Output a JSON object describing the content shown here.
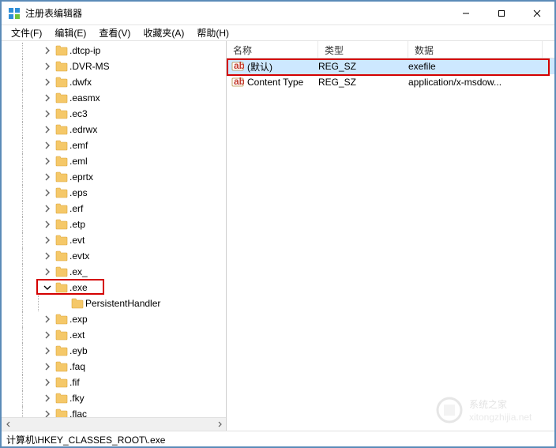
{
  "window": {
    "title": "注册表编辑器",
    "controls": {
      "min": "—",
      "max": "☐",
      "close": "✕"
    }
  },
  "menu": {
    "file": "文件(F)",
    "edit": "编辑(E)",
    "view": "查看(V)",
    "fav": "收藏夹(A)",
    "help": "帮助(H)"
  },
  "tree": {
    "items": [
      {
        "label": ".dtcp-ip",
        "depth": 3,
        "exp": "right"
      },
      {
        "label": ".DVR-MS",
        "depth": 3,
        "exp": "right"
      },
      {
        "label": ".dwfx",
        "depth": 3,
        "exp": "right"
      },
      {
        "label": ".easmx",
        "depth": 3,
        "exp": "right"
      },
      {
        "label": ".ec3",
        "depth": 3,
        "exp": "right"
      },
      {
        "label": ".edrwx",
        "depth": 3,
        "exp": "right"
      },
      {
        "label": ".emf",
        "depth": 3,
        "exp": "right"
      },
      {
        "label": ".eml",
        "depth": 3,
        "exp": "right"
      },
      {
        "label": ".eprtx",
        "depth": 3,
        "exp": "right"
      },
      {
        "label": ".eps",
        "depth": 3,
        "exp": "right"
      },
      {
        "label": ".erf",
        "depth": 3,
        "exp": "right"
      },
      {
        "label": ".etp",
        "depth": 3,
        "exp": "right"
      },
      {
        "label": ".evt",
        "depth": 3,
        "exp": "right"
      },
      {
        "label": ".evtx",
        "depth": 3,
        "exp": "right"
      },
      {
        "label": ".ex_",
        "depth": 3,
        "exp": "right"
      },
      {
        "label": ".exe",
        "depth": 3,
        "exp": "down",
        "highlight": true
      },
      {
        "label": "PersistentHandler",
        "depth": 4,
        "exp": "none"
      },
      {
        "label": ".exp",
        "depth": 3,
        "exp": "right"
      },
      {
        "label": ".ext",
        "depth": 3,
        "exp": "right"
      },
      {
        "label": ".eyb",
        "depth": 3,
        "exp": "right"
      },
      {
        "label": ".faq",
        "depth": 3,
        "exp": "right"
      },
      {
        "label": ".fif",
        "depth": 3,
        "exp": "right"
      },
      {
        "label": ".fky",
        "depth": 3,
        "exp": "right"
      },
      {
        "label": ".flac",
        "depth": 3,
        "exp": "right"
      }
    ]
  },
  "list": {
    "columns": {
      "name": "名称",
      "type": "类型",
      "data": "数据"
    },
    "widths": {
      "name": 116,
      "type": 114,
      "data": 170
    },
    "rows": [
      {
        "name": "(默认)",
        "type": "REG_SZ",
        "data": "exefile",
        "selected": true
      },
      {
        "name": "Content Type",
        "type": "REG_SZ",
        "data": "application/x-msdow...",
        "selected": false
      }
    ]
  },
  "statusbar": {
    "path": "计算机\\HKEY_CLASSES_ROOT\\.exe"
  },
  "watermark": {
    "brand": "系统之家",
    "url": "xitongzhijia.net"
  }
}
